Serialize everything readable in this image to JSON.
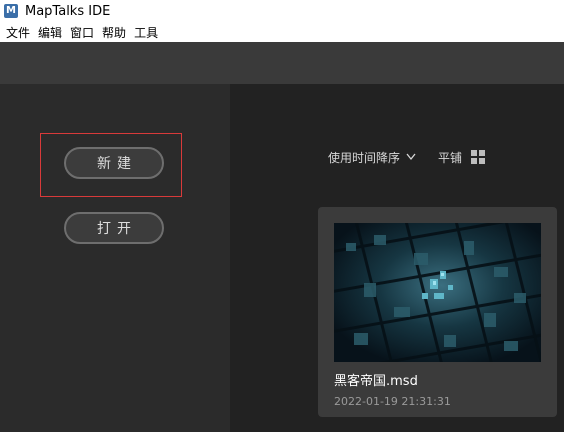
{
  "window": {
    "title": "MapTalks IDE",
    "logo_letter": "M"
  },
  "menu": {
    "items": [
      "文件",
      "编辑",
      "窗口",
      "帮助",
      "工具"
    ]
  },
  "left": {
    "new_label": "新建",
    "open_label": "打开"
  },
  "right": {
    "sort_label": "使用时间降序",
    "layout_label": "平铺",
    "project": {
      "name": "黑客帝国.msd",
      "date": "2022-01-19 21:31:31"
    }
  },
  "colors": {
    "highlight": "#d93a3a",
    "toolbar": "#3a3a3a",
    "panel_left": "#2b2b2b",
    "panel_right": "#222222",
    "card": "#3b3b3b"
  }
}
